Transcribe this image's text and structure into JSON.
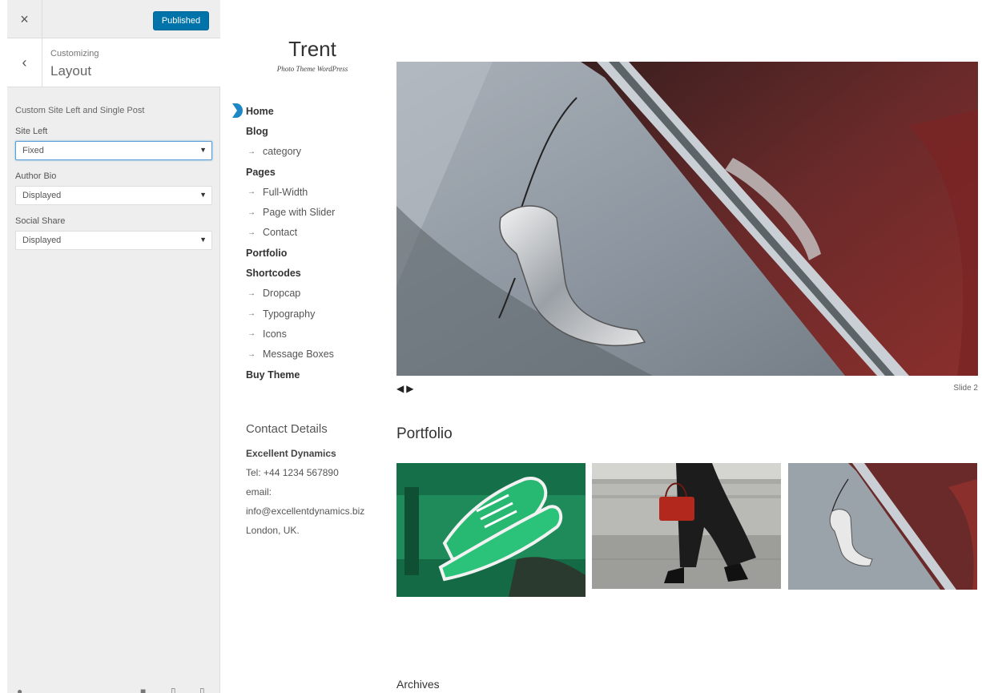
{
  "customizer": {
    "publish_label": "Published",
    "close_label": "×",
    "back_label": "‹",
    "breadcrumb": "Customizing",
    "section_title": "Layout",
    "description": "Custom Site Left and Single Post",
    "controls": [
      {
        "label": "Site Left",
        "value": "Fixed"
      },
      {
        "label": "Author Bio",
        "value": "Displayed"
      },
      {
        "label": "Social Share",
        "value": "Displayed"
      }
    ],
    "accent_color": "#0073aa"
  },
  "site": {
    "title": "Trent",
    "tagline": "Photo Theme WordPress"
  },
  "nav": {
    "items": [
      {
        "label": "Home",
        "level": "top"
      },
      {
        "label": "Blog",
        "level": "top"
      },
      {
        "label": "category",
        "level": "sub"
      },
      {
        "label": "Pages",
        "level": "top"
      },
      {
        "label": "Full-Width",
        "level": "sub"
      },
      {
        "label": "Page with Slider",
        "level": "sub"
      },
      {
        "label": "Contact",
        "level": "sub"
      },
      {
        "label": "Portfolio",
        "level": "top"
      },
      {
        "label": "Shortcodes",
        "level": "top"
      },
      {
        "label": "Dropcap",
        "level": "sub"
      },
      {
        "label": "Typography",
        "level": "sub"
      },
      {
        "label": "Icons",
        "level": "sub"
      },
      {
        "label": "Message Boxes",
        "level": "sub"
      },
      {
        "label": "Buy Theme",
        "level": "top"
      }
    ]
  },
  "contact": {
    "heading": "Contact Details",
    "company": "Excellent Dynamics",
    "tel": "Tel: +44 1234 567890",
    "email_label": "email:",
    "email": "info@excellentdynamics.biz",
    "location": "London, UK."
  },
  "slider": {
    "counter": "Slide 2"
  },
  "portfolio": {
    "heading": "Portfolio",
    "items": [
      {
        "icon": "sneakers-photo"
      },
      {
        "icon": "handbag-street-photo"
      },
      {
        "icon": "car-door-photo"
      }
    ]
  },
  "archives": {
    "heading": "Archives"
  }
}
